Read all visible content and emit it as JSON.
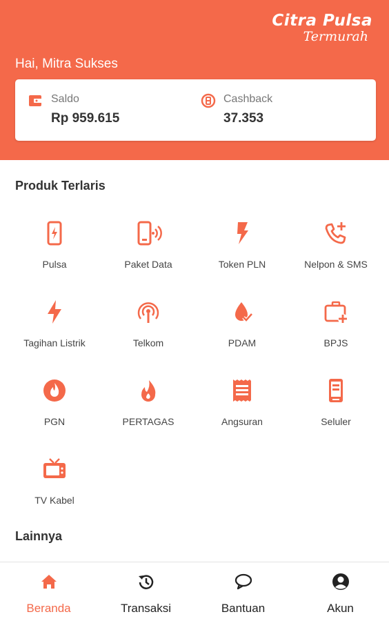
{
  "colors": {
    "accent": "#f4694a",
    "text": "#333333",
    "muted": "#777777",
    "nav_inactive": "#222222"
  },
  "brand": {
    "name": "Citra Pulsa",
    "tagline": "Termurah"
  },
  "greeting": "Hai, Mitra Sukses",
  "balance": {
    "saldo": {
      "label": "Saldo",
      "value": "Rp 959.615",
      "icon": "wallet-icon"
    },
    "cashback": {
      "label": "Cashback",
      "value": "37.353",
      "icon": "cashback-icon"
    }
  },
  "sections": {
    "best_sellers": "Produk Terlaris",
    "others": "Lainnya"
  },
  "products": [
    {
      "label": "Pulsa",
      "icon": "phone-bolt-icon"
    },
    {
      "label": "Paket Data",
      "icon": "phone-data-icon"
    },
    {
      "label": "Token PLN",
      "icon": "lightning-icon"
    },
    {
      "label": "Nelpon & SMS",
      "icon": "phone-plus-icon"
    },
    {
      "label": "Tagihan Listrik",
      "icon": "bolt-icon"
    },
    {
      "label": "Telkom",
      "icon": "antenna-icon"
    },
    {
      "label": "PDAM",
      "icon": "water-drop-icon"
    },
    {
      "label": "BPJS",
      "icon": "medical-bag-icon"
    },
    {
      "label": "PGN",
      "icon": "gas-flame-icon"
    },
    {
      "label": "PERTAGAS",
      "icon": "fire-icon"
    },
    {
      "label": "Angsuran",
      "icon": "receipt-icon"
    },
    {
      "label": "Seluler",
      "icon": "mobile-icon"
    },
    {
      "label": "TV Kabel",
      "icon": "tv-icon"
    }
  ],
  "nav": [
    {
      "label": "Beranda",
      "icon": "home-icon",
      "active": true
    },
    {
      "label": "Transaksi",
      "icon": "history-icon",
      "active": false
    },
    {
      "label": "Bantuan",
      "icon": "chat-icon",
      "active": false
    },
    {
      "label": "Akun",
      "icon": "account-icon",
      "active": false
    }
  ]
}
